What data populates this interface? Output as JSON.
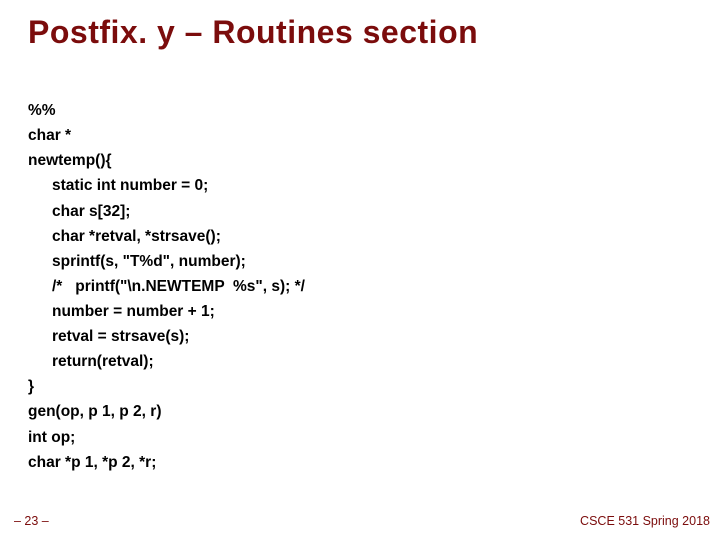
{
  "title": "Postfix. y – Routines section",
  "code": {
    "l0": "%%",
    "l1": "char *",
    "l2": "newtemp(){",
    "l3": "static int number = 0;",
    "l4": "char s[32];",
    "l5": "char *retval, *strsave();",
    "l6": "sprintf(s, \"T%d\", number);",
    "l7": "/*   printf(\"\\n.NEWTEMP  %s\", s); */",
    "l8": "number = number + 1;",
    "l9": "retval = strsave(s);",
    "l10": "return(retval);",
    "l11": "}",
    "l12": "gen(op, p 1, p 2, r)",
    "l13": "int op;",
    "l14": "char *p 1, *p 2, *r;"
  },
  "footer": {
    "left": "– 23 –",
    "right": "CSCE 531 Spring 2018"
  }
}
